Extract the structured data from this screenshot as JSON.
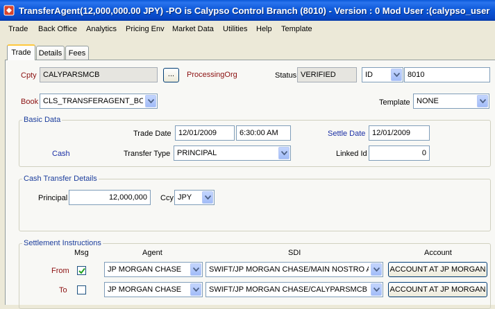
{
  "window": {
    "title": "TransferAgent(12,000,000.00 JPY)  -PO is Calypso Control Branch  (8010) - Version : 0 Mod User :(calypso_user"
  },
  "menu": {
    "items": [
      "Trade",
      "Back Office",
      "Analytics",
      "Pricing Env",
      "Market Data",
      "Utilities",
      "Help",
      "Template"
    ]
  },
  "tabs": [
    "Trade",
    "Details",
    "Fees"
  ],
  "header": {
    "cpty_label": "Cpty",
    "cpty_value": "CALYPARSMCB",
    "cpty_button": "...",
    "processing_org_label": "ProcessingOrg",
    "status_label": "Status",
    "status_value": "VERIFIED",
    "id_type": "ID",
    "id_value": "8010",
    "book_label": "Book",
    "book_value": "CLS_TRANSFERAGENT_BOOK",
    "template_label": "Template",
    "template_value": "NONE"
  },
  "basic_data": {
    "title": "Basic Data",
    "trade_date_label": "Trade Date",
    "trade_date": "12/01/2009",
    "trade_time": "6:30:00 AM",
    "settle_date_label": "Settle Date",
    "settle_date": "12/01/2009",
    "cash_label": "Cash",
    "transfer_type_label": "Transfer Type",
    "transfer_type": "PRINCIPAL",
    "linked_id_label": "Linked Id",
    "linked_id": "0"
  },
  "cash_transfer": {
    "title": "Cash Transfer Details",
    "principal_label": "Principal",
    "principal": "12,000,000",
    "ccy_label": "Ccy",
    "ccy": "JPY"
  },
  "settlement": {
    "title": "Settlement Instructions",
    "col_msg": "Msg",
    "col_agent": "Agent",
    "col_sdi": "SDI",
    "col_account": "Account",
    "rows": [
      {
        "label": "From",
        "msg_checked": true,
        "agent": "JP MORGAN CHASE",
        "sdi": "SWIFT/JP MORGAN CHASE/MAIN NOSTRO A...",
        "account": "ACCOUNT AT JP MORGAN"
      },
      {
        "label": "To",
        "msg_checked": false,
        "agent": "JP MORGAN CHASE",
        "sdi": "SWIFT/JP MORGAN CHASE/CALYPARSMCB CL...",
        "account": "ACCOUNT AT JP MORGAN"
      }
    ]
  },
  "colors": {
    "title_bar": "#0b56d6",
    "field_label_red": "#8b1010",
    "field_label_blue": "#1b2fa5",
    "group_title": "#1b3d9c"
  },
  "icons": {
    "app": "calypso-app-icon",
    "dropdown": "chevron-down-icon",
    "check": "checkmark-icon"
  }
}
